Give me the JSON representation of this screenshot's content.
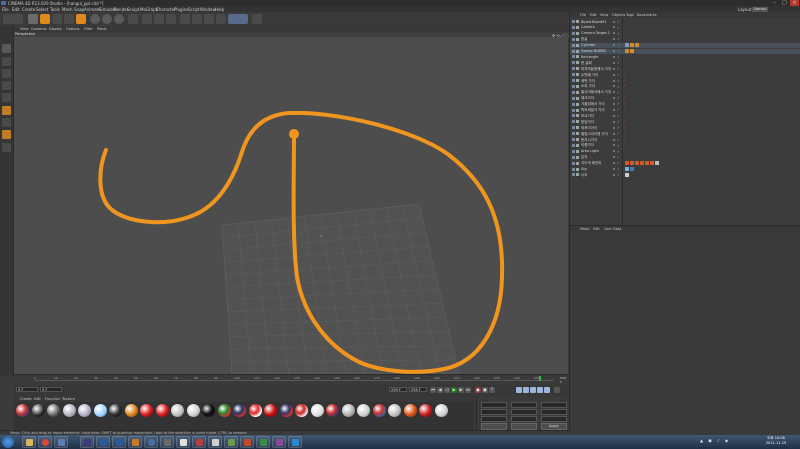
{
  "app": {
    "title": "CINEMA 4D R13.029 Studio - [hangul_ppl.c4d *]",
    "layout_label": "Layout:",
    "layout_value": "Startup"
  },
  "menubar": [
    "File",
    "Edit",
    "Create",
    "Select",
    "Tools",
    "Mesh",
    "Snap",
    "Animate",
    "Simulate",
    "Render",
    "Sculpt",
    "MoGraph",
    "Character",
    "Plugins",
    "Script",
    "Window",
    "Help"
  ],
  "viewport": {
    "menu": [
      "View",
      "Cameras",
      "Display",
      "Options",
      "Filter",
      "Panel"
    ],
    "label": "Perspective",
    "stroke_color": "#f0961e"
  },
  "timeline": {
    "ticks": [
      "0",
      "10",
      "20",
      "30",
      "40",
      "50",
      "60",
      "70",
      "80",
      "90",
      "100",
      "110",
      "120",
      "130",
      "140",
      "150",
      "160",
      "170",
      "180",
      "190",
      "200",
      "210",
      "220",
      "230",
      "240",
      "250"
    ],
    "end_label": "256 F"
  },
  "transport": {
    "start_field": "0 F",
    "current_field": "0 F",
    "end_field": "256 F",
    "min_field": "256 F"
  },
  "material_manager": {
    "menu": [
      "Create",
      "Edit",
      "Function",
      "Texture"
    ]
  },
  "object_manager": {
    "menu": [
      "File",
      "Edit",
      "View",
      "Objects",
      "Tags",
      "Bookmarks"
    ],
    "objects": [
      {
        "name": "Biped.Biped01"
      },
      {
        "name": "Camera"
      },
      {
        "name": "Camera.Target.1"
      },
      {
        "name": "한글"
      },
      {
        "name": "Cylinder"
      },
      {
        "name": "Sweep NURBS"
      },
      {
        "name": "Rectangle"
      },
      {
        "name": "한 글획"
      },
      {
        "name": "마지막끝점에서 가이"
      },
      {
        "name": "두번째 가이"
      },
      {
        "name": "세번 가이"
      },
      {
        "name": "소리 가이"
      },
      {
        "name": "팔사이에서에서 가이"
      },
      {
        "name": "체크가이"
      },
      {
        "name": "기울임에서 가이"
      },
      {
        "name": "학모세밀가 가이"
      },
      {
        "name": "보교기이"
      },
      {
        "name": "방당가이"
      },
      {
        "name": "와포이가이"
      },
      {
        "name": "필립스아이엔 가이"
      },
      {
        "name": "한지시가이"
      },
      {
        "name": "이름가이"
      },
      {
        "name": "Area Light"
      },
      {
        "name": "임지"
      },
      {
        "name": "각도의 회전하"
      },
      {
        "name": "Sky"
      },
      {
        "name": "나무"
      }
    ]
  },
  "attribute_manager": {
    "menu": [
      "Mode",
      "Edit",
      "User Data"
    ]
  },
  "attr_panel": {
    "apply_label": "Apply"
  },
  "statusbar": {
    "text": "Move: Click and drag to move elements. Hold down SHIFT to quantize movement / add to the selection in point mode, CTRL to remove."
  },
  "taskbar": {
    "time": "오후 10:06",
    "date": "2011-11-29"
  }
}
